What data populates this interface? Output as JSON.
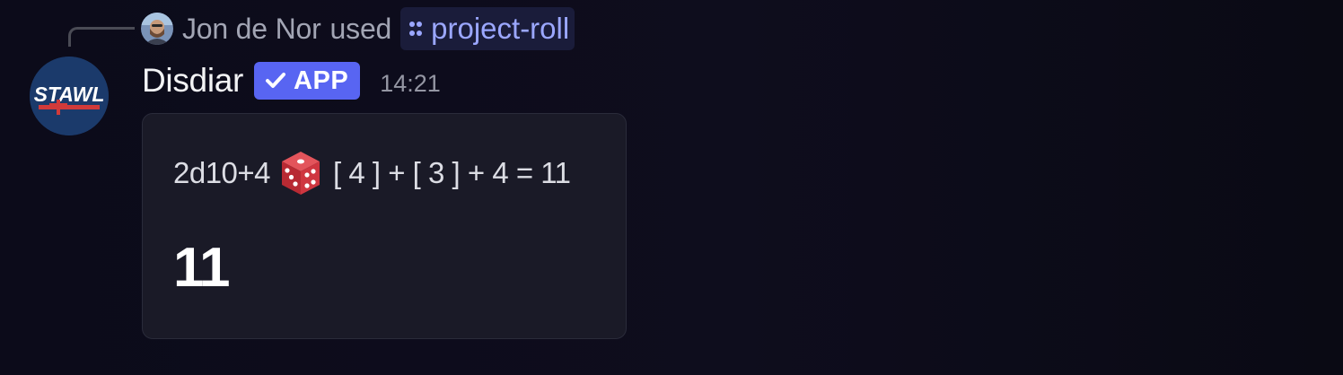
{
  "reply": {
    "user": "Jon de Nor",
    "verb": "used",
    "command": "project-roll",
    "avatar_icon": "user-avatar-icon",
    "command_icon": "app-command-icon"
  },
  "message": {
    "author": "Disdiar",
    "badge": "APP",
    "timestamp": "14:21",
    "avatar_text": "STAWL",
    "avatar_icon": "stawl-logo-icon"
  },
  "embed": {
    "formula": "2d10+4",
    "dice_icon": "red-die-icon",
    "breakdown": "[ 4 ] + [ 3 ] + 4 = 11",
    "total": "11"
  },
  "colors": {
    "background": "#0c0b1a",
    "accent": "#5865f2",
    "command_text": "#9ba7ff",
    "embed_background": "#1a1a27",
    "die": "#c8323b"
  }
}
